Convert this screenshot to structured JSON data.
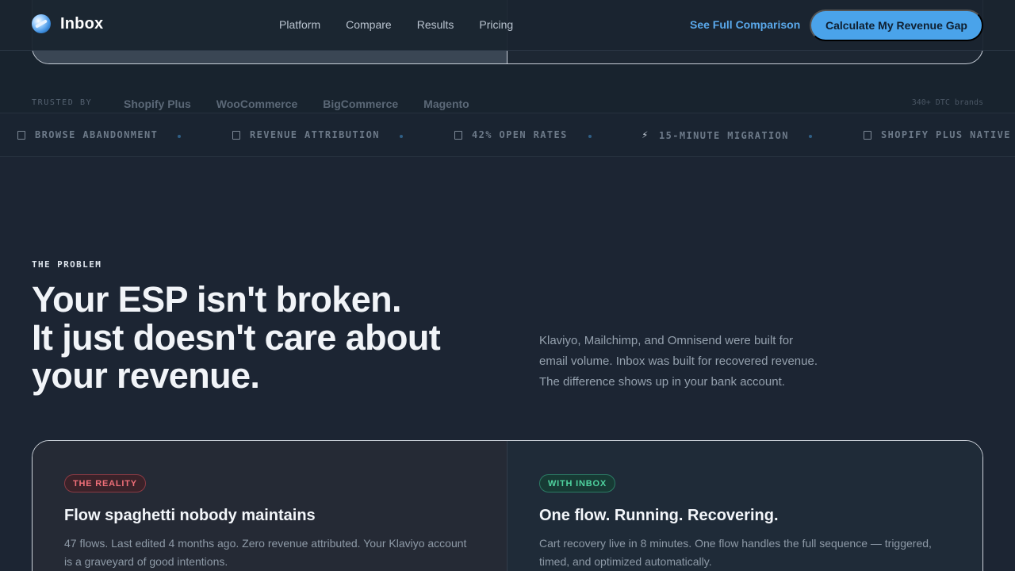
{
  "nav": {
    "brand": "Inbox",
    "links": [
      "Platform",
      "Compare",
      "Results",
      "Pricing"
    ],
    "secondary_cta": "See Full Comparison",
    "primary_cta": "Calculate My Revenue Gap"
  },
  "trusted": {
    "label": "TRUSTED BY",
    "brands": [
      "Shopify Plus",
      "WooCommerce",
      "BigCommerce",
      "Magento"
    ],
    "count": "340+ DTC brands"
  },
  "ticker": {
    "items": [
      {
        "icon": "square-icon",
        "label": "BROWSE ABANDONMENT"
      },
      {
        "icon": "square-icon",
        "label": "REVENUE ATTRIBUTION"
      },
      {
        "icon": "square-icon",
        "label": "42% OPEN RATES"
      },
      {
        "icon": "bolt-icon",
        "label": "15-MINUTE MIGRATION"
      },
      {
        "icon": "square-icon",
        "label": "SHOPIFY PLUS NATIVE"
      }
    ]
  },
  "problem": {
    "eyebrow": "THE PROBLEM",
    "headline_lines": [
      "Your ESP isn't broken.",
      "It just doesn't care about",
      "your revenue."
    ],
    "intro_lines": [
      "Klaviyo, Mailchimp, and Omnisend were built for",
      "email volume. Inbox was built for recovered revenue.",
      "The difference shows up in your bank account."
    ]
  },
  "comparison": {
    "reality": {
      "badge": "THE REALITY",
      "title": "Flow spaghetti nobody maintains",
      "body_lines": [
        "47 flows. Last edited 4 months ago. Zero revenue attributed. Your Klaviyo account",
        "is a graveyard of good intentions."
      ]
    },
    "inbox": {
      "badge": "WITH INBOX",
      "title": "One flow. Running. Recovering.",
      "body_lines": [
        "Cart recovery live in 8 minutes. One flow handles the full sequence — triggered,",
        "timed, and optimized automatically."
      ]
    }
  },
  "colors": {
    "background": "#1c2533",
    "accent": "#4aa3ea",
    "reality_red": "#ef6f78",
    "inbox_green": "#4fd39f"
  }
}
